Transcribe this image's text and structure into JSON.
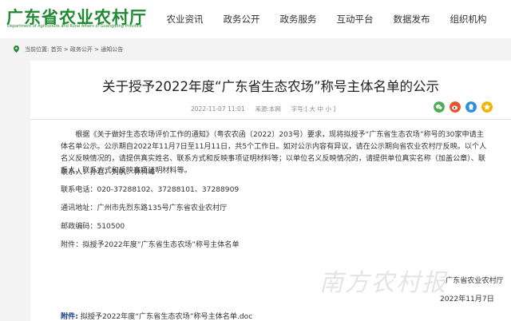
{
  "header": {
    "logo_title": "广东省农业农村厅",
    "logo_subtitle": "Department of Agriculture and Rural Affairs of Guangdong Province",
    "nav": [
      "农业资讯",
      "政务公开",
      "政务服务",
      "互动平台",
      "数据发布",
      "组织机构"
    ]
  },
  "breadcrumb": {
    "prefix": "当前位置:",
    "items": [
      "首页",
      "政务公开",
      "通知公告"
    ],
    "separator": " > "
  },
  "article": {
    "title": "关于授予2022年度“广东省生态农场”称号主体名单的公示",
    "date": "2022-11-07 11:01",
    "source_label": "来源:",
    "source": "本网",
    "size_label": "字号:",
    "size_open": "[",
    "size_close": "]",
    "sizes": [
      "大",
      "中",
      "小"
    ],
    "paragraph": "根据《关于做好生态农场评价工作的通知》（粤农农函〔2022〕203号）要求，现将拟授予“广东省生态农场”称号的30家申请主体名单公示。公示期自2022年11月7日至11月11日，共5个工作日。如对公示内容有异议，请在公示期向省农业农村厅反映。以个人名义反映情况的，请提供真实姓名、联系方式和反映事项证明材料等；以单位名义反映情况的，请提供单位真实名称（加盖公章）、联系人、联系方式和反映事项证明材料等。",
    "contact_person": "联系人：孙岩、刘帆、林科峰",
    "phone": "联系电话：020-37288102、37288101、37288909",
    "address": "通讯地址：广州市先烈东路135号广东省农业农村厅",
    "postcode": "邮政编码：510500",
    "attachment_line": "附件：拟授予2022年度“广东省生态农场”称号主体名单",
    "signer": "广东省农业农村厅",
    "sign_date": "2022年11月7日",
    "attach_label": "附件:",
    "attach_file": "拟授予2022年度“广东省生态农场”称号主体名单.doc",
    "watermark": "南方农村报"
  },
  "share_icons": [
    {
      "name": "wechat-share-icon",
      "color": "#4caf50"
    },
    {
      "name": "weibo-share-icon",
      "color": "#e8532f"
    },
    {
      "name": "qq-share-icon",
      "color": "#2e8ee0"
    },
    {
      "name": "qzone-share-icon",
      "color": "#f0b400"
    }
  ],
  "colors": {
    "brand_green": "#1f8a32",
    "link_blue": "#1d3f8f",
    "background": "#f2f3f2"
  }
}
